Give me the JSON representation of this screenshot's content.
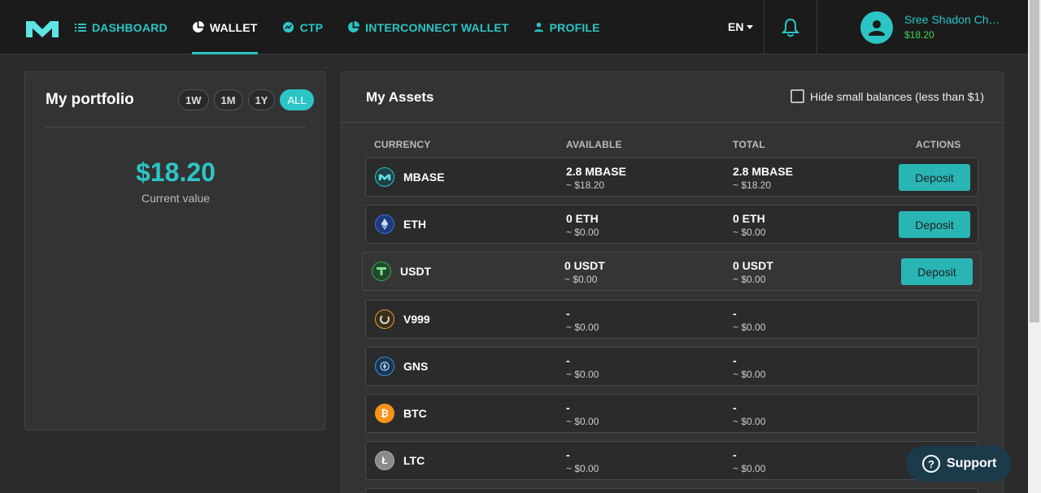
{
  "nav": {
    "items": [
      {
        "label": "DASHBOARD",
        "icon": "list-icon"
      },
      {
        "label": "WALLET",
        "icon": "pie-chart-icon",
        "active": true
      },
      {
        "label": "CTP",
        "icon": "ctp-icon"
      },
      {
        "label": "INTERCONNECT WALLET",
        "icon": "pie-chart-icon"
      },
      {
        "label": "PROFILE",
        "icon": "person-icon"
      }
    ],
    "language": "EN",
    "user_name": "Sree Shadon Chakraborty",
    "user_balance": "$18.20"
  },
  "portfolio": {
    "title": "My portfolio",
    "ranges": [
      "1W",
      "1M",
      "1Y",
      "ALL"
    ],
    "active_range": "ALL",
    "value": "$18.20",
    "value_label": "Current value"
  },
  "assets": {
    "title": "My Assets",
    "hide_small_label": "Hide small balances (less than $1)",
    "columns": [
      "CURRENCY",
      "AVAILABLE",
      "TOTAL",
      "ACTIONS"
    ],
    "rows": [
      {
        "name": "MBASE",
        "available": "2.8 MBASE",
        "available_usd": "~ $18.20",
        "total": "2.8 MBASE",
        "total_usd": "~ $18.20",
        "action": "Deposit"
      },
      {
        "name": "ETH",
        "available": "0 ETH",
        "available_usd": "~ $0.00",
        "total": "0 ETH",
        "total_usd": "~ $0.00",
        "action": "Deposit"
      },
      {
        "name": "USDT",
        "available": "0 USDT",
        "available_usd": "~ $0.00",
        "total": "0 USDT",
        "total_usd": "~ $0.00",
        "action": "Deposit"
      },
      {
        "name": "V999",
        "available": "-",
        "available_usd": "~ $0.00",
        "total": "-",
        "total_usd": "~ $0.00",
        "action": ""
      },
      {
        "name": "GNS",
        "available": "-",
        "available_usd": "~ $0.00",
        "total": "-",
        "total_usd": "~ $0.00",
        "action": ""
      },
      {
        "name": "BTC",
        "available": "-",
        "available_usd": "~ $0.00",
        "total": "-",
        "total_usd": "~ $0.00",
        "action": ""
      },
      {
        "name": "LTC",
        "available": "-",
        "available_usd": "~ $0.00",
        "total": "-",
        "total_usd": "~ $0.00",
        "action": ""
      }
    ]
  },
  "support": {
    "label": "Support"
  },
  "colors": {
    "accent": "#2cc5c5",
    "balance_green": "#3fd651",
    "background": "#2b2b2b"
  }
}
